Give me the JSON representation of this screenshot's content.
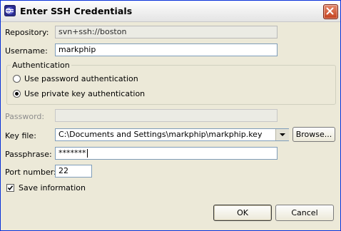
{
  "window": {
    "title": "Enter SSH Credentials",
    "icon": "eclipse-app-icon",
    "close_icon": "close-icon"
  },
  "form": {
    "repository": {
      "label": "Repository:",
      "value": "svn+ssh://boston"
    },
    "username": {
      "label": "Username:",
      "value": "markphip"
    },
    "authentication": {
      "legend": "Authentication",
      "options": [
        {
          "label": "Use password authentication",
          "selected": false
        },
        {
          "label": "Use private key authentication",
          "selected": true
        }
      ]
    },
    "password": {
      "label": "Password:",
      "value": "",
      "enabled": false
    },
    "key_file": {
      "label": "Key file:",
      "value": "C:\\Documents and Settings\\markphip\\markphip.key",
      "browse_label": "Browse..."
    },
    "passphrase": {
      "label": "Passphrase:",
      "value": "*******"
    },
    "port": {
      "label": "Port number:",
      "value": "22"
    },
    "save_info": {
      "label": "Save information",
      "checked": true
    }
  },
  "buttons": {
    "ok": "OK",
    "cancel": "Cancel"
  }
}
